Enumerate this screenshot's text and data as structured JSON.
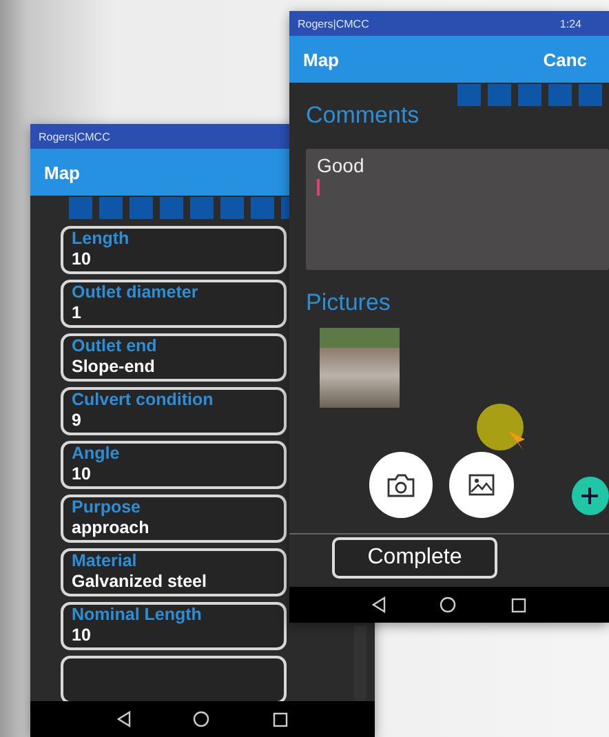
{
  "left_phone": {
    "status_bar": {
      "carrier": "Rogers|CMCC"
    },
    "app_bar": {
      "title": "Map"
    },
    "fields": [
      {
        "label": "Length",
        "value": "10"
      },
      {
        "label": "Outlet diameter",
        "value": "1"
      },
      {
        "label": "Outlet end",
        "value": "Slope-end"
      },
      {
        "label": "Culvert condition",
        "value": "9"
      },
      {
        "label": "Angle",
        "value": "10"
      },
      {
        "label": "Purpose",
        "value": "approach"
      },
      {
        "label": "Material",
        "value": "Galvanized steel"
      },
      {
        "label": "Nominal Length",
        "value": "10"
      }
    ]
  },
  "right_phone": {
    "status_bar": {
      "carrier": "Rogers|CMCC",
      "time": "1:24"
    },
    "app_bar": {
      "title": "Map",
      "action": "Canc"
    },
    "comments": {
      "heading": "Comments",
      "value": "Good"
    },
    "pictures": {
      "heading": "Pictures"
    },
    "complete_button": "Complete"
  }
}
